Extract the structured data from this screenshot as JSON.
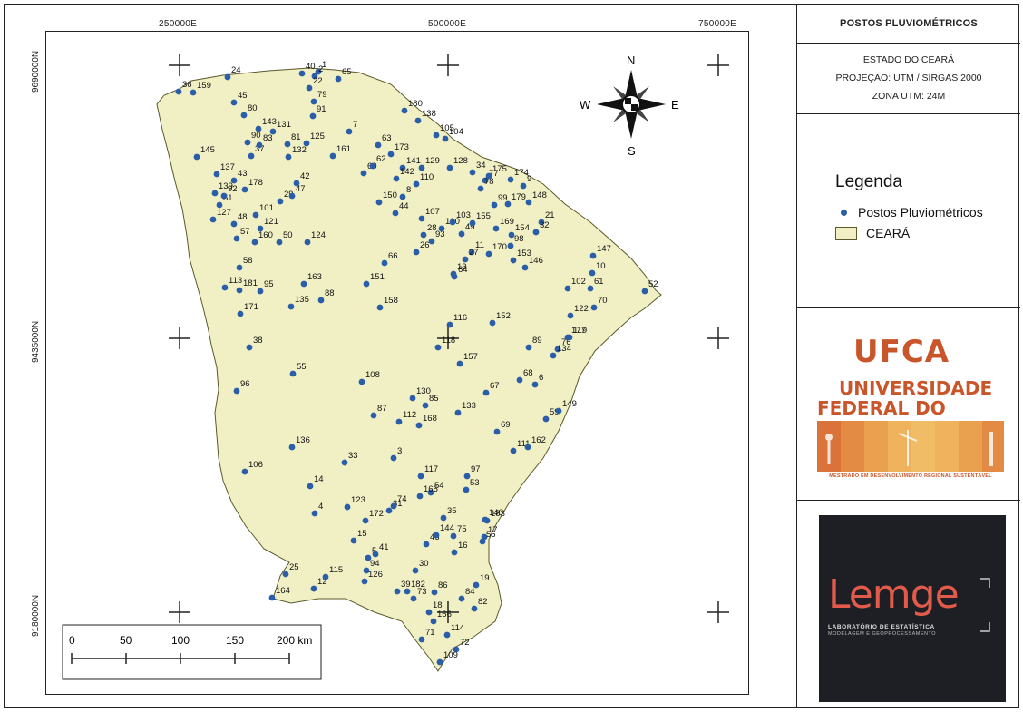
{
  "panel": {
    "title": "POSTOS PLUVIOMÉTRICOS",
    "state": "ESTADO DO CEARÁ",
    "projection": "PROJEÇÃO: UTM / SIRGAS 2000",
    "zone": "ZONA UTM: 24M"
  },
  "legend": {
    "title": "Legenda",
    "stations_label": "Postos Pluviométricos",
    "ceara_label": "CEARÁ",
    "station_color": "#2b5ea8",
    "ceara_fill": "#f1efc4"
  },
  "grid": {
    "x_labels": [
      "250000E",
      "500000E",
      "750000E"
    ],
    "y_labels": [
      "9690000N",
      "9435000N",
      "9180000N"
    ]
  },
  "compass": {
    "n": "N",
    "s": "S",
    "e": "E",
    "w": "W"
  },
  "scale_bar": {
    "labels": [
      "0",
      "50",
      "100",
      "150",
      "200 km"
    ]
  },
  "logos": {
    "ufca_acronym": "UFCA",
    "ufca_line1": "UNIVERSIDADE",
    "ufca_line2": "FEDERAL DO CARIRI",
    "ufca_program": "MESTRADO EM DESENVOLVIMENTO REGIONAL SUSTENTÁVEL",
    "lemge_word": "Lemge",
    "lemge_line1": "LABORATÓRIO DE ESTATÍSTICA",
    "lemge_line2": "MODELAGEM E GEOPROCESSAMENTO"
  },
  "stations": [
    {
      "id": "1"
    },
    {
      "id": "2"
    },
    {
      "id": "3"
    },
    {
      "id": "4"
    },
    {
      "id": "5"
    },
    {
      "id": "6"
    },
    {
      "id": "7"
    },
    {
      "id": "8"
    },
    {
      "id": "9"
    },
    {
      "id": "10"
    },
    {
      "id": "11"
    },
    {
      "id": "12"
    },
    {
      "id": "13"
    },
    {
      "id": "14"
    },
    {
      "id": "15"
    },
    {
      "id": "16"
    },
    {
      "id": "17"
    },
    {
      "id": "18"
    },
    {
      "id": "19"
    },
    {
      "id": "21"
    },
    {
      "id": "22"
    },
    {
      "id": "24"
    },
    {
      "id": "25"
    },
    {
      "id": "26"
    },
    {
      "id": "27"
    },
    {
      "id": "28"
    },
    {
      "id": "29"
    },
    {
      "id": "30"
    },
    {
      "id": "31"
    },
    {
      "id": "32"
    },
    {
      "id": "33"
    },
    {
      "id": "34"
    },
    {
      "id": "35"
    },
    {
      "id": "36"
    },
    {
      "id": "37"
    },
    {
      "id": "38"
    },
    {
      "id": "39"
    },
    {
      "id": "40"
    },
    {
      "id": "41"
    },
    {
      "id": "42"
    },
    {
      "id": "43"
    },
    {
      "id": "44"
    },
    {
      "id": "45"
    },
    {
      "id": "46"
    },
    {
      "id": "47"
    },
    {
      "id": "48"
    },
    {
      "id": "49"
    },
    {
      "id": "50"
    },
    {
      "id": "51"
    },
    {
      "id": "52"
    },
    {
      "id": "53"
    },
    {
      "id": "54"
    },
    {
      "id": "55"
    },
    {
      "id": "56"
    },
    {
      "id": "57"
    },
    {
      "id": "58"
    },
    {
      "id": "59"
    },
    {
      "id": "60"
    },
    {
      "id": "61"
    },
    {
      "id": "62"
    },
    {
      "id": "63"
    },
    {
      "id": "64"
    },
    {
      "id": "65"
    },
    {
      "id": "66"
    },
    {
      "id": "67"
    },
    {
      "id": "68"
    },
    {
      "id": "69"
    },
    {
      "id": "70"
    },
    {
      "id": "71"
    },
    {
      "id": "72"
    },
    {
      "id": "73"
    },
    {
      "id": "74"
    },
    {
      "id": "75"
    },
    {
      "id": "76"
    },
    {
      "id": "77"
    },
    {
      "id": "78"
    },
    {
      "id": "79"
    },
    {
      "id": "80"
    },
    {
      "id": "81"
    },
    {
      "id": "82"
    },
    {
      "id": "83"
    },
    {
      "id": "84"
    },
    {
      "id": "85"
    },
    {
      "id": "86"
    },
    {
      "id": "87"
    },
    {
      "id": "88"
    },
    {
      "id": "89"
    },
    {
      "id": "90"
    },
    {
      "id": "91"
    },
    {
      "id": "92"
    },
    {
      "id": "93"
    },
    {
      "id": "94"
    },
    {
      "id": "95"
    },
    {
      "id": "96"
    },
    {
      "id": "97"
    },
    {
      "id": "98"
    },
    {
      "id": "99"
    },
    {
      "id": "100"
    },
    {
      "id": "101"
    },
    {
      "id": "102"
    },
    {
      "id": "103"
    },
    {
      "id": "104"
    },
    {
      "id": "105"
    },
    {
      "id": "106"
    },
    {
      "id": "107"
    },
    {
      "id": "108"
    },
    {
      "id": "109"
    },
    {
      "id": "110"
    },
    {
      "id": "111"
    },
    {
      "id": "112"
    },
    {
      "id": "113"
    },
    {
      "id": "114"
    },
    {
      "id": "115"
    },
    {
      "id": "116"
    },
    {
      "id": "117"
    },
    {
      "id": "118"
    },
    {
      "id": "119"
    },
    {
      "id": "121"
    },
    {
      "id": "122"
    },
    {
      "id": "123"
    },
    {
      "id": "124"
    },
    {
      "id": "125"
    },
    {
      "id": "126"
    },
    {
      "id": "127"
    },
    {
      "id": "128"
    },
    {
      "id": "129"
    },
    {
      "id": "130"
    },
    {
      "id": "131"
    },
    {
      "id": "132"
    },
    {
      "id": "133"
    },
    {
      "id": "134"
    },
    {
      "id": "135"
    },
    {
      "id": "136"
    },
    {
      "id": "137"
    },
    {
      "id": "138"
    },
    {
      "id": "139"
    },
    {
      "id": "140"
    },
    {
      "id": "141"
    },
    {
      "id": "142"
    },
    {
      "id": "143"
    },
    {
      "id": "144"
    },
    {
      "id": "145"
    },
    {
      "id": "146"
    },
    {
      "id": "147"
    },
    {
      "id": "148"
    },
    {
      "id": "149"
    },
    {
      "id": "150"
    },
    {
      "id": "151"
    },
    {
      "id": "152"
    },
    {
      "id": "153"
    },
    {
      "id": "154"
    },
    {
      "id": "155"
    },
    {
      "id": "157"
    },
    {
      "id": "158"
    },
    {
      "id": "159"
    },
    {
      "id": "160"
    },
    {
      "id": "161"
    },
    {
      "id": "162"
    },
    {
      "id": "163"
    },
    {
      "id": "164"
    },
    {
      "id": "165"
    },
    {
      "id": "166"
    },
    {
      "id": "167"
    },
    {
      "id": "168"
    },
    {
      "id": "169"
    },
    {
      "id": "170"
    },
    {
      "id": "171"
    },
    {
      "id": "172"
    },
    {
      "id": "173"
    },
    {
      "id": "174"
    },
    {
      "id": "175"
    },
    {
      "id": "177"
    },
    {
      "id": "178"
    },
    {
      "id": "179"
    },
    {
      "id": "180"
    },
    {
      "id": "181"
    },
    {
      "id": "182"
    },
    {
      "id": "183"
    }
  ]
}
